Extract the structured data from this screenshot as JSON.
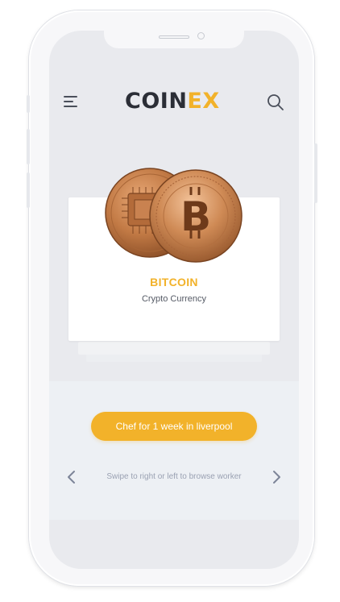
{
  "app": {
    "logo_text": "COIN",
    "logo_accent_text": "EX"
  },
  "header": {
    "menu_icon": "hamburger-menu-icon",
    "search_icon": "search-icon"
  },
  "coin_card": {
    "name": "BITCOIN",
    "subtitle": "Crypto Currency",
    "image": "bitcoin-coins-image"
  },
  "action": {
    "button_label": "Chef for 1 week in liverpool"
  },
  "pager": {
    "hint": "Swipe to right or left to browse worker",
    "prev_icon": "chevron-left-icon",
    "next_icon": "chevron-right-icon"
  },
  "colors": {
    "accent": "#f2b22a",
    "logo_dark": "#2b2e36",
    "screen_bg": "#e9eaee",
    "panel_bg": "#edf0f4",
    "hint_text": "#9aa1b2"
  }
}
